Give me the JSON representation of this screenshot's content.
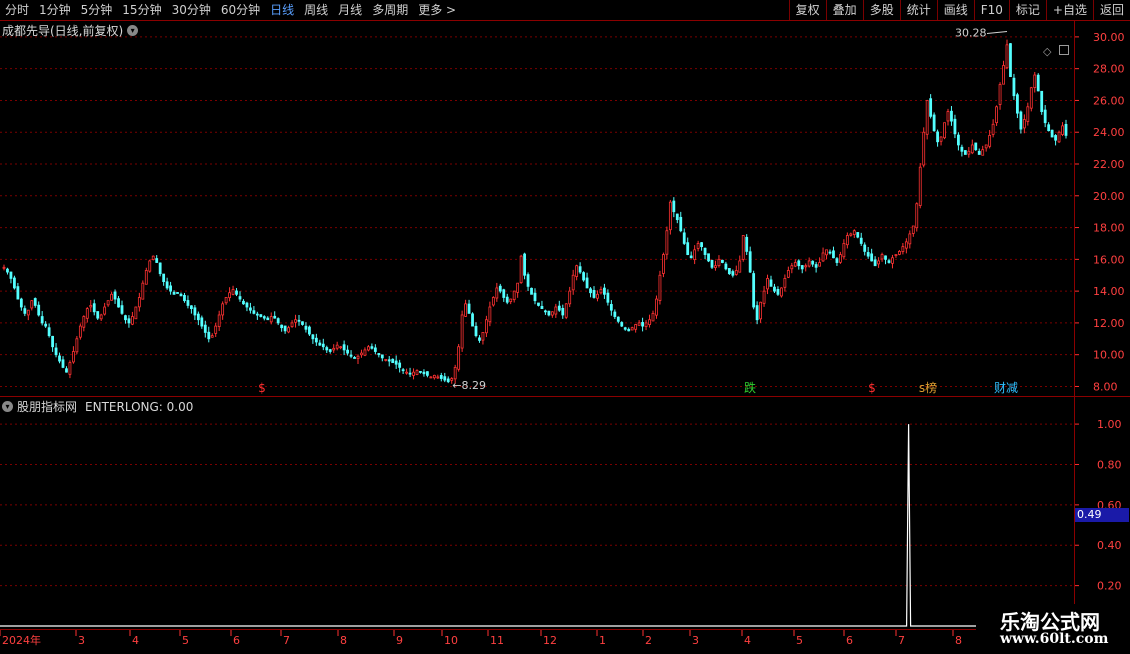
{
  "toolbar": {
    "periods": [
      "分时",
      "1分钟",
      "5分钟",
      "15分钟",
      "30分钟",
      "60分钟",
      "日线",
      "周线",
      "月线",
      "多周期",
      "更多 >"
    ],
    "active_period": "日线",
    "buttons": [
      "复权",
      "叠加",
      "多股",
      "统计",
      "画线",
      "F10",
      "标记",
      "+自选",
      "返回"
    ]
  },
  "main_panel": {
    "title": "成都先导(日线,前复权)",
    "high_label": "30.28",
    "low_label": "8.29",
    "y_ticks": [
      "30.00",
      "28.00",
      "26.00",
      "24.00",
      "22.00",
      "20.00",
      "18.00",
      "16.00",
      "14.00",
      "12.00",
      "10.00",
      "8.00"
    ],
    "markers": [
      {
        "text": "$",
        "color": "#ff3030"
      },
      {
        "text": "跌",
        "color": "#30d030"
      },
      {
        "text": "$",
        "color": "#ff3030"
      },
      {
        "text": "s榜",
        "color": "#e0a030"
      },
      {
        "text": "财减",
        "color": "#30c0ff"
      }
    ]
  },
  "indicator_panel": {
    "title": "股朋指标网",
    "series_label": "ENTERLONG: 0.00",
    "y_ticks": [
      "1.00",
      "0.80",
      "0.60",
      "0.40",
      "0.20"
    ],
    "current_value": "0.49"
  },
  "x_axis": {
    "labels": [
      "2024年",
      "3",
      "4",
      "5",
      "6",
      "7",
      "8",
      "9",
      "10",
      "11",
      "12",
      "1",
      "2",
      "3",
      "4",
      "5",
      "6",
      "7",
      "8"
    ]
  },
  "watermark": {
    "line1": "乐淘公式网",
    "line2": "www.60lt.com"
  },
  "colors": {
    "up": "#ff3232",
    "down": "#54ffff",
    "grid": "#8b0000",
    "axis_text": "#ff4040"
  },
  "chart_data": [
    {
      "type": "candlestick",
      "title": "成都先导(日线,前复权)",
      "ylim": [
        7.4,
        31.0
      ],
      "y_ticks": [
        30,
        28,
        26,
        24,
        22,
        20,
        18,
        16,
        14,
        12,
        10,
        8
      ],
      "high": 30.28,
      "low": 8.29,
      "close_path": [
        15.5,
        15.2,
        14.8,
        14.2,
        13.5,
        13.0,
        12.6,
        12.8,
        13.4,
        13.1,
        12.5,
        12.0,
        11.8,
        11.2,
        10.5,
        10.0,
        9.6,
        9.2,
        8.9,
        9.5,
        10.2,
        11.0,
        11.8,
        12.4,
        12.9,
        13.1,
        12.7,
        12.3,
        12.5,
        13.0,
        13.4,
        13.8,
        13.5,
        13.0,
        12.6,
        12.2,
        12.0,
        12.4,
        13.0,
        13.6,
        14.5,
        15.3,
        15.9,
        16.2,
        15.8,
        15.1,
        14.6,
        14.2,
        14.0,
        13.8,
        13.9,
        13.7,
        13.4,
        13.1,
        12.9,
        12.5,
        12.2,
        11.8,
        11.4,
        11.0,
        11.2,
        11.8,
        12.5,
        13.2,
        13.6,
        13.9,
        14.1,
        13.8,
        13.5,
        13.2,
        13.0,
        12.8,
        12.6,
        12.5,
        12.4,
        12.3,
        12.2,
        12.4,
        12.3,
        12.0,
        11.7,
        11.5,
        11.7,
        12.0,
        12.2,
        12.1,
        11.9,
        11.6,
        11.3,
        11.0,
        10.8,
        10.6,
        10.5,
        10.3,
        10.2,
        10.4,
        10.6,
        10.5,
        10.3,
        10.1,
        9.9,
        9.8,
        9.9,
        10.1,
        10.3,
        10.5,
        10.4,
        10.2,
        10.0,
        9.8,
        9.7,
        9.6,
        9.5,
        9.4,
        9.2,
        9.0,
        8.9,
        8.8,
        8.9,
        9.0,
        8.9,
        8.8,
        8.7,
        8.6,
        8.7,
        8.6,
        8.5,
        8.4,
        8.3,
        8.5,
        9.2,
        10.5,
        12.5,
        13.2,
        12.6,
        11.8,
        11.2,
        10.9,
        11.4,
        12.2,
        13.0,
        13.6,
        14.2,
        14.0,
        13.6,
        13.3,
        13.5,
        14.0,
        14.5,
        16.2,
        15.0,
        14.3,
        13.8,
        13.4,
        13.1,
        12.9,
        12.7,
        12.5,
        12.7,
        13.0,
        12.8,
        12.5,
        13.2,
        14.0,
        15.0,
        15.6,
        15.2,
        14.7,
        14.2,
        13.9,
        13.6,
        13.8,
        14.1,
        13.8,
        13.3,
        12.8,
        12.4,
        12.1,
        11.8,
        11.6,
        11.5,
        11.7,
        11.9,
        12.0,
        11.8,
        12.0,
        12.2,
        12.6,
        13.5,
        15.0,
        16.3,
        17.8,
        19.6,
        19.0,
        18.5,
        17.8,
        17.0,
        16.3,
        16.1,
        16.6,
        17.0,
        16.8,
        16.3,
        15.9,
        15.5,
        15.6,
        16.0,
        15.8,
        15.4,
        15.1,
        15.0,
        15.3,
        15.9,
        17.5,
        16.5,
        15.2,
        13.0,
        12.2,
        13.3,
        14.0,
        14.8,
        14.3,
        14.0,
        13.8,
        14.2,
        14.8,
        15.3,
        15.6,
        15.8,
        15.6,
        15.4,
        15.6,
        15.9,
        15.7,
        15.5,
        15.8,
        16.4,
        16.6,
        16.4,
        16.1,
        15.8,
        16.3,
        17.0,
        17.5,
        17.6,
        17.8,
        17.4,
        17.0,
        16.5,
        16.2,
        15.9,
        15.6,
        15.9,
        16.3,
        16.0,
        15.8,
        16.1,
        16.3,
        16.5,
        16.8,
        17.1,
        17.6,
        18.1,
        19.5,
        21.8,
        24.0,
        26.0,
        25.0,
        24.1,
        23.4,
        23.7,
        24.6,
        25.3,
        24.7,
        23.9,
        23.2,
        22.8,
        22.6,
        22.8,
        23.2,
        22.9,
        22.6,
        22.9,
        23.2,
        23.8,
        24.5,
        25.6,
        27.0,
        28.2,
        29.5,
        27.5,
        26.3,
        25.2,
        24.2,
        24.8,
        25.6,
        26.8,
        27.6,
        26.6,
        25.3,
        24.6,
        24.1,
        23.7,
        23.5,
        24.0,
        24.4,
        23.8
      ]
    },
    {
      "type": "line",
      "title": "ENTERLONG",
      "ylim": [
        0,
        1.05
      ],
      "y_ticks": [
        1.0,
        0.8,
        0.6,
        0.4,
        0.2
      ],
      "values_description_points": [
        {
          "x_index": 0,
          "y": 0
        },
        {
          "x_index": 300,
          "y": 0
        },
        {
          "x_index": 301,
          "y": 1.0
        },
        {
          "x_index": 302,
          "y": 0
        }
      ],
      "spike_position_fraction": 0.846
    }
  ]
}
